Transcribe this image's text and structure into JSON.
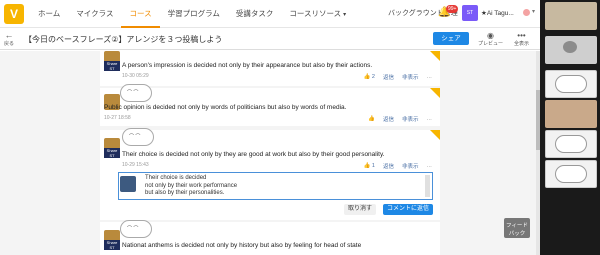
{
  "nav": {
    "items": [
      "ホーム",
      "マイクラス",
      "コース",
      "学習プログラム",
      "受講タスク",
      "コースリソース"
    ],
    "active_index": 2,
    "bg_manage": "バックグラウンド管理",
    "badge": "99+",
    "user_name": "★Ai Tagu..."
  },
  "titlebar": {
    "back": "戻る",
    "title": "【今日のベースフレーズ②】アレンジを３つ投稿しよう",
    "share": "シェア",
    "preview": "プレビュー",
    "fullscreen": "全表示"
  },
  "posts": [
    {
      "text": "A person's impression is decided not only by their appearance but also by their actions.",
      "date": "10-30 05:29",
      "likes": "2",
      "reply": "返信",
      "hide": "非表示",
      "more": "…"
    },
    {
      "text": "Public opinion is decided not only by words of politicians but also by words of media.",
      "date": "10-27 18:58",
      "likes": "",
      "reply": "返信",
      "hide": "非表示",
      "more": "…"
    },
    {
      "text": "Their choice is decided not only by they are good at work but also by their good personality.",
      "date": "10-29 15:43",
      "likes": "1",
      "reply": "返信",
      "hide": "非表示",
      "more": "…"
    },
    {
      "text": "Nationat anthems is decided not only by history but also by feeling for head of state",
      "date": "",
      "likes": "",
      "reply": "",
      "hide": "",
      "more": ""
    }
  ],
  "reply_box": {
    "lines": [
      "Their choice is decided",
      "not only by their work performance",
      "but also by their personalities."
    ]
  },
  "buttons": {
    "cancel": "取り消す",
    "submit": "コメントに返信"
  },
  "avatar_label": "Share ST",
  "feedback": "フィード\nバック",
  "colors": {
    "accent": "#f08c00",
    "primary": "#1e88e5"
  }
}
